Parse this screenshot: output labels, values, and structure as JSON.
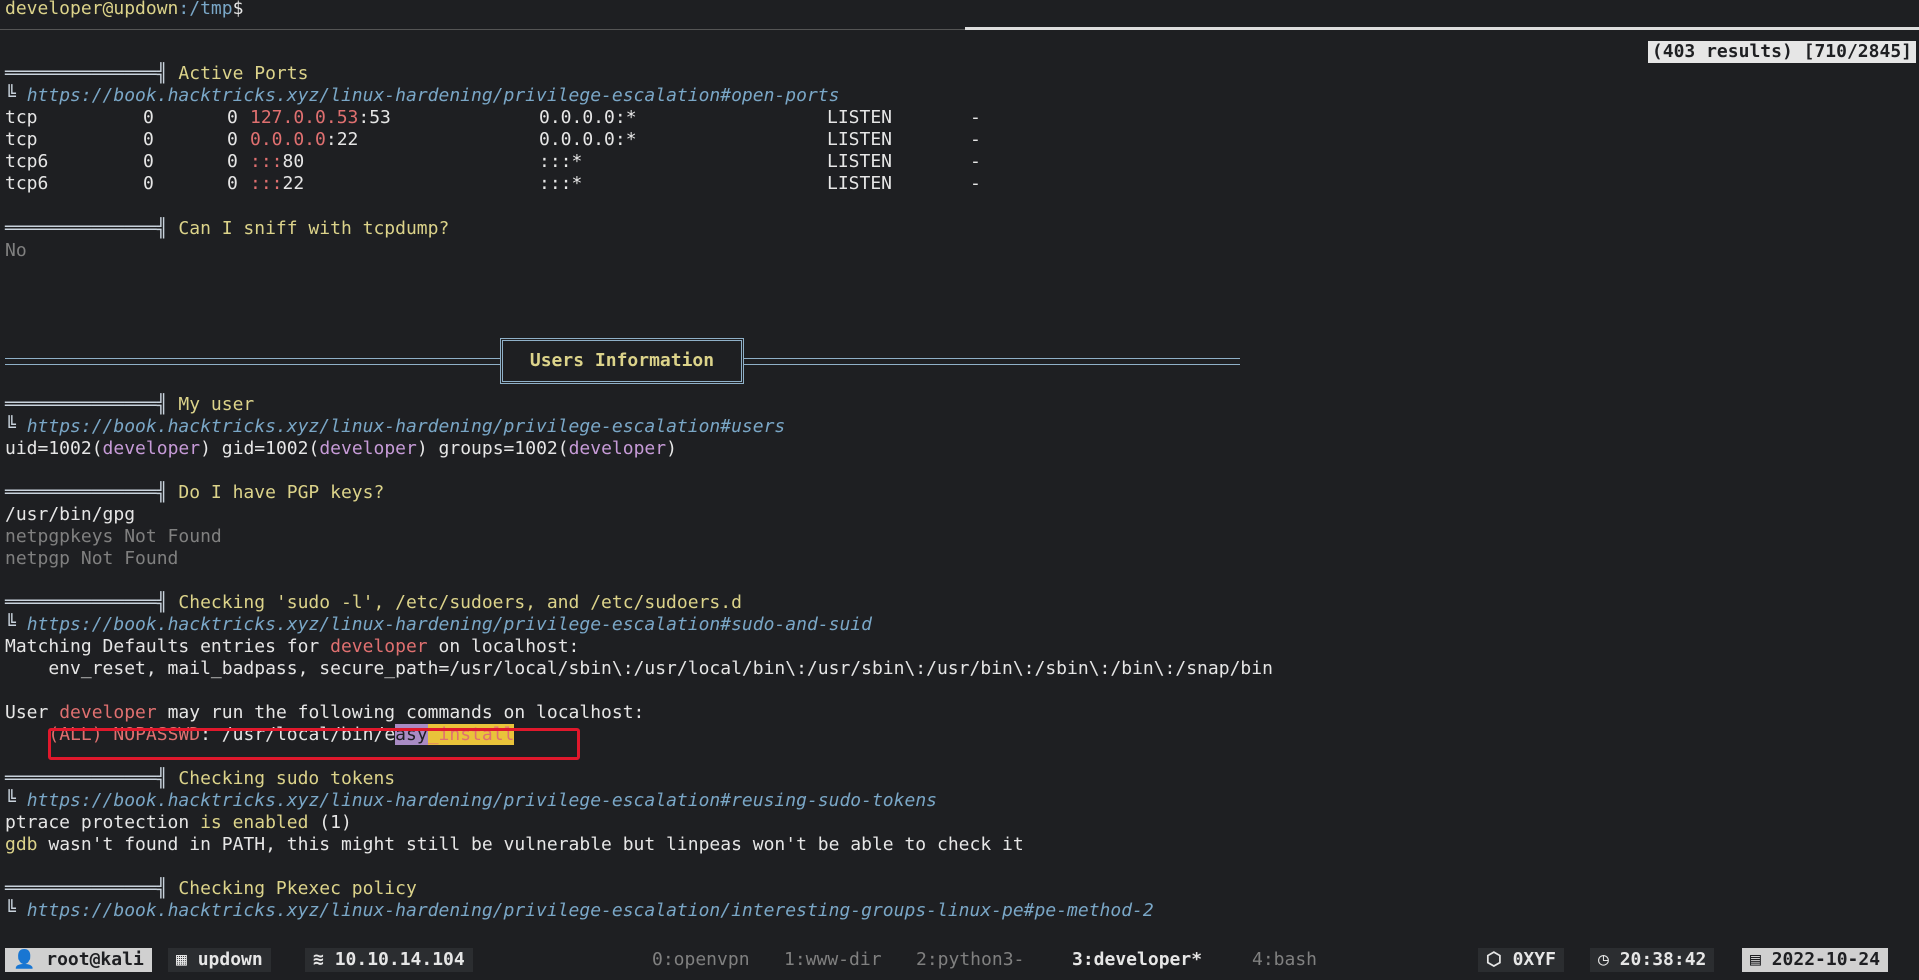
{
  "prompt": {
    "user_host": "developer@updown",
    "path": ":/tmp",
    "symbol": "$"
  },
  "search_status": "(403 results) [710/2845]",
  "active_ports": {
    "title": "Active Ports",
    "url": "https://book.hacktricks.xyz/linux-hardening/privilege-escalation#open-ports",
    "rows": [
      {
        "proto": "tcp",
        "recv": "0",
        "send": "0",
        "local": "127.0.0.53",
        "port": ":53",
        "foreign": "0.0.0.0:*",
        "state": "LISTEN",
        "pid": "-"
      },
      {
        "proto": "tcp",
        "recv": "0",
        "send": "0",
        "local": "0.0.0.0",
        "port": ":22",
        "foreign": "0.0.0.0:*",
        "state": "LISTEN",
        "pid": "-"
      },
      {
        "proto": "tcp6",
        "recv": "0",
        "send": "0",
        "local": ":::",
        "port": "80",
        "foreign": ":::*",
        "state": "LISTEN",
        "pid": "-"
      },
      {
        "proto": "tcp6",
        "recv": "0",
        "send": "0",
        "local": ":::",
        "port": "22",
        "foreign": ":::*",
        "state": "LISTEN",
        "pid": "-"
      }
    ]
  },
  "sniff": {
    "title": "Can I sniff with tcpdump?",
    "result": "No"
  },
  "users_section": {
    "title": "Users Information"
  },
  "my_user": {
    "title": "My user",
    "url": "https://book.hacktricks.xyz/linux-hardening/privilege-escalation#users",
    "line": {
      "p1": "uid=1002(",
      "u1": "developer",
      "p2": ") gid=1002(",
      "u2": "developer",
      "p3": ") groups=1002(",
      "u3": "developer",
      "p4": ")"
    }
  },
  "pgp": {
    "title": "Do I have PGP keys?",
    "lines": [
      "/usr/bin/gpg",
      "netpgpkeys Not Found",
      "netpgp Not Found"
    ]
  },
  "sudo": {
    "title": "Checking 'sudo -l', /etc/sudoers, and /etc/sudoers.d",
    "url": "https://book.hacktricks.xyz/linux-hardening/privilege-escalation#sudo-and-suid",
    "defaults_prefix": "Matching Defaults entries for ",
    "defaults_user": "developer",
    "defaults_suffix": " on localhost:",
    "defaults_line": "    env_reset, mail_badpass, secure_path=/usr/local/sbin\\:/usr/local/bin\\:/usr/sbin\\:/usr/bin\\:/sbin\\:/bin\\:/snap/bin",
    "may_prefix": "User ",
    "may_user": "developer",
    "may_suffix": " may run the following commands on localhost:",
    "cmd_all": "(ALL)",
    "cmd_nopass": "NOPASSWD",
    "cmd_path_a": ": /usr/local/bin/e",
    "cmd_path_sel": "asy",
    "cmd_path_hl": "_install"
  },
  "sudo_tokens": {
    "title": "Checking sudo tokens",
    "url": "https://book.hacktricks.xyz/linux-hardening/privilege-escalation#reusing-sudo-tokens",
    "ptrace_a": "ptrace protection ",
    "ptrace_b": "is enabled",
    "ptrace_c": " (1)",
    "gdb_a": "gdb",
    "gdb_b": " wasn't found in PATH, this might still be vulnerable but linpeas won't be able to check it"
  },
  "pkexec": {
    "title": "Checking Pkexec policy",
    "url": "https://book.hacktricks.xyz/linux-hardening/privilege-escalation/interesting-groups-linux-pe#pe-method-2"
  },
  "statusbar": {
    "user": "root@kali",
    "session": "updown",
    "ip": "10.10.14.104",
    "windows": [
      "0:openvpn",
      "1:www-dir",
      "2:python3-",
      "3:developer*",
      "4:bash"
    ],
    "brand": "0XYF",
    "time": "20:38:42",
    "date": "2022-10-24"
  }
}
